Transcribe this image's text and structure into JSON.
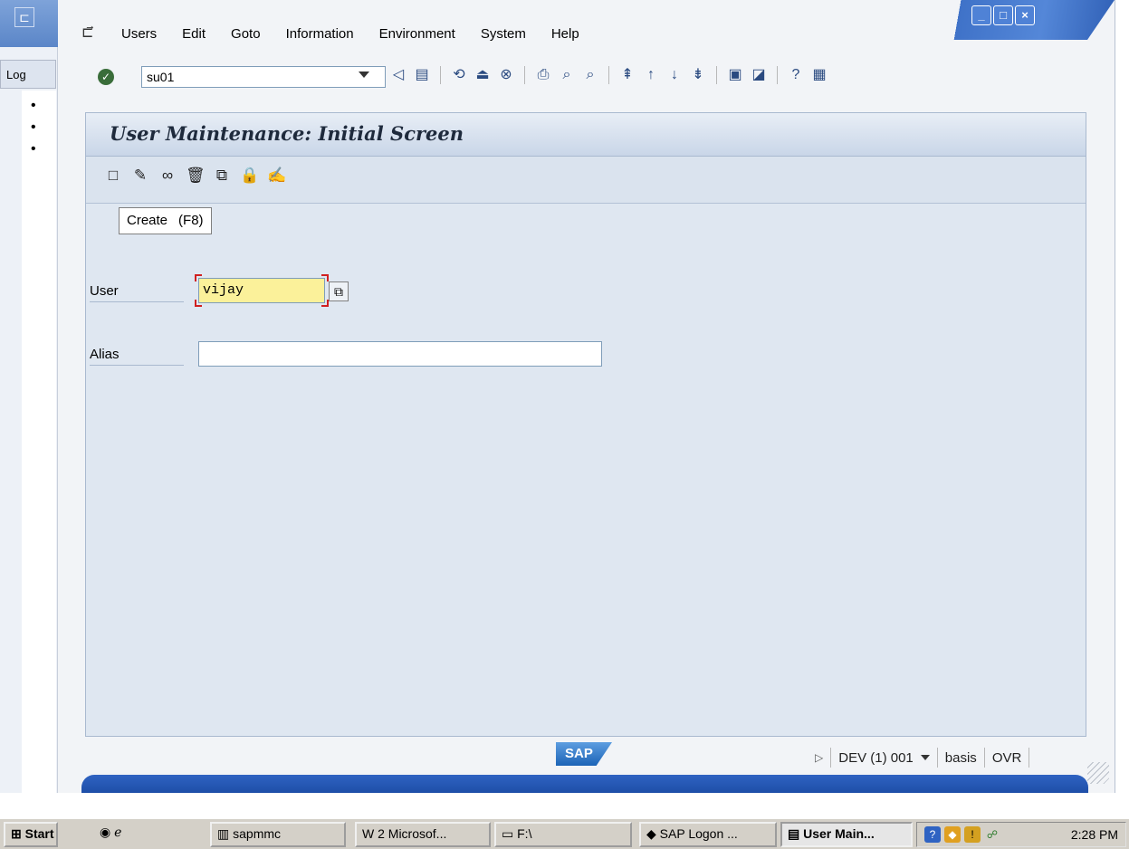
{
  "background_window": {
    "label": "Log",
    "bullets": [
      "•",
      "•",
      "•"
    ]
  },
  "window": {
    "controls": [
      "_",
      "□",
      "×"
    ]
  },
  "menu": {
    "items": [
      "Users",
      "Edit",
      "Goto",
      "Information",
      "Environment",
      "System",
      "Help"
    ]
  },
  "toolbar": {
    "command_value": "su01"
  },
  "screen": {
    "title": "User Maintenance: Initial Screen",
    "tooltip_text": "Create",
    "tooltip_shortcut": "(F8)",
    "user_label": "User",
    "user_value": "vijay",
    "alias_label": "Alias",
    "alias_value": ""
  },
  "status": {
    "logo": "SAP",
    "system": "DEV (1) 001",
    "client_user": "basis",
    "mode": "OVR"
  },
  "taskbar": {
    "start": "Start",
    "items": [
      "sapmmc",
      "2 Microsof...",
      "F:\\",
      "SAP Logon ...",
      "User Main..."
    ],
    "time": "2:28 PM"
  },
  "colors": {
    "required_field": "#fbf19a",
    "title_gradient": "#c9d6e8",
    "sap_blue": "#1c64b7"
  }
}
